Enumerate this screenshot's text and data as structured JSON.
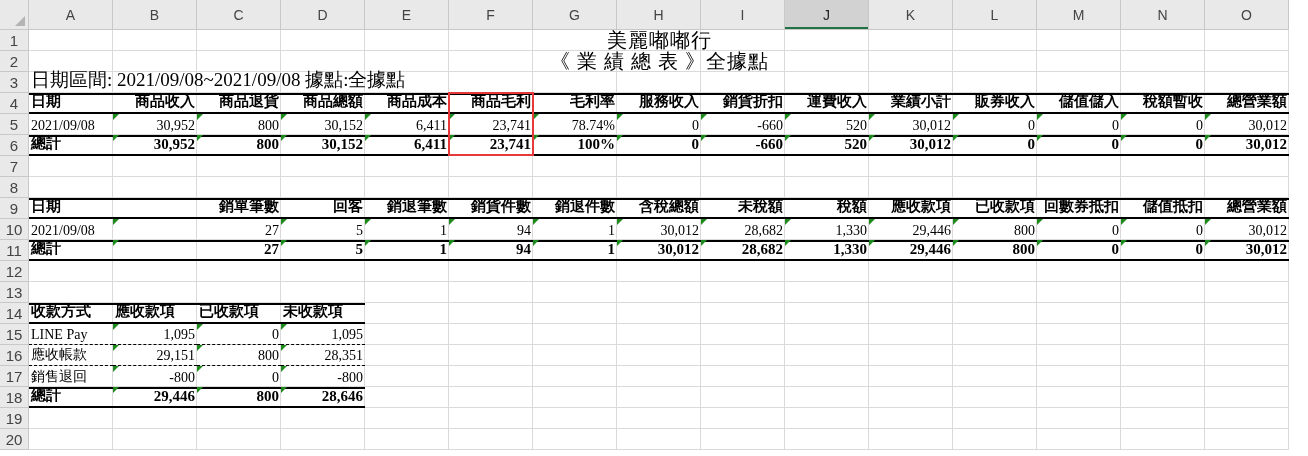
{
  "columns": [
    {
      "label": "A",
      "selected": false
    },
    {
      "label": "B",
      "selected": false
    },
    {
      "label": "C",
      "selected": false
    },
    {
      "label": "D",
      "selected": false
    },
    {
      "label": "E",
      "selected": false
    },
    {
      "label": "F",
      "selected": false
    },
    {
      "label": "G",
      "selected": false
    },
    {
      "label": "H",
      "selected": false
    },
    {
      "label": "I",
      "selected": false
    },
    {
      "label": "J",
      "selected": true
    },
    {
      "label": "K",
      "selected": false
    },
    {
      "label": "L",
      "selected": false
    },
    {
      "label": "M",
      "selected": false
    },
    {
      "label": "N",
      "selected": false
    },
    {
      "label": "O",
      "selected": false
    }
  ],
  "rows": [
    {
      "number": "1",
      "kind": "title",
      "cells": [
        {
          "text": "美麗嘟嘟行",
          "kind": "center"
        }
      ]
    },
    {
      "number": "2",
      "kind": "title",
      "cells": [
        {
          "text": "《 業 績 總 表 》全據點",
          "kind": "center"
        }
      ]
    },
    {
      "number": "3",
      "kind": "note",
      "cells": [
        {
          "text": "日期區間: 2021/09/08~2021/09/08 據點:全據點",
          "kind": "label"
        }
      ]
    },
    {
      "number": "4",
      "kind": "header",
      "cells": [
        {
          "text": "日期",
          "kind": "label",
          "flag": false,
          "outlined": false
        },
        {
          "text": "商品收入",
          "kind": "number",
          "flag": false,
          "outlined": false
        },
        {
          "text": "商品退貨",
          "kind": "number",
          "flag": false,
          "outlined": false
        },
        {
          "text": "商品總額",
          "kind": "number",
          "flag": false,
          "outlined": false
        },
        {
          "text": "商品成本",
          "kind": "number",
          "flag": false,
          "outlined": false
        },
        {
          "text": "商品毛利",
          "kind": "number",
          "flag": false,
          "outlined": true
        },
        {
          "text": "毛利率",
          "kind": "number",
          "flag": false,
          "outlined": false
        },
        {
          "text": "服務收入",
          "kind": "number",
          "flag": false,
          "outlined": false
        },
        {
          "text": "銷貨折扣",
          "kind": "number",
          "flag": false,
          "outlined": false
        },
        {
          "text": "運費收入",
          "kind": "number",
          "flag": false,
          "outlined": false
        },
        {
          "text": "業績小計",
          "kind": "number",
          "flag": false,
          "outlined": false
        },
        {
          "text": "販券收入",
          "kind": "number",
          "flag": false,
          "outlined": false
        },
        {
          "text": "儲值儲入",
          "kind": "number",
          "flag": false,
          "outlined": false
        },
        {
          "text": "稅額暫收",
          "kind": "number",
          "flag": false,
          "outlined": false
        },
        {
          "text": "總營業額",
          "kind": "number",
          "flag": false,
          "outlined": false
        }
      ]
    },
    {
      "number": "5",
      "kind": "data",
      "cells": [
        {
          "text": "2021/09/08",
          "kind": "label",
          "flag": false,
          "outlined": false
        },
        {
          "text": "30,952",
          "kind": "number",
          "flag": true,
          "outlined": false
        },
        {
          "text": "800",
          "kind": "number",
          "flag": true,
          "outlined": false
        },
        {
          "text": "30,152",
          "kind": "number",
          "flag": true,
          "outlined": false
        },
        {
          "text": "6,411",
          "kind": "number",
          "flag": true,
          "outlined": false
        },
        {
          "text": "23,741",
          "kind": "number",
          "flag": true,
          "outlined": true
        },
        {
          "text": "78.74%",
          "kind": "number",
          "flag": true,
          "outlined": false
        },
        {
          "text": "0",
          "kind": "number",
          "flag": true,
          "outlined": false
        },
        {
          "text": "-660",
          "kind": "number",
          "flag": true,
          "outlined": false
        },
        {
          "text": "520",
          "kind": "number",
          "flag": true,
          "outlined": false
        },
        {
          "text": "30,012",
          "kind": "number",
          "flag": true,
          "outlined": false
        },
        {
          "text": "0",
          "kind": "number",
          "flag": true,
          "outlined": false
        },
        {
          "text": "0",
          "kind": "number",
          "flag": true,
          "outlined": false
        },
        {
          "text": "0",
          "kind": "number",
          "flag": true,
          "outlined": false
        },
        {
          "text": "30,012",
          "kind": "number",
          "flag": true,
          "outlined": false
        }
      ]
    },
    {
      "number": "6",
      "kind": "total",
      "cells": [
        {
          "text": "總計",
          "kind": "label",
          "flag": false,
          "outlined": false
        },
        {
          "text": "30,952",
          "kind": "number",
          "flag": true,
          "outlined": false
        },
        {
          "text": "800",
          "kind": "number",
          "flag": true,
          "outlined": false
        },
        {
          "text": "30,152",
          "kind": "number",
          "flag": true,
          "outlined": false
        },
        {
          "text": "6,411",
          "kind": "number",
          "flag": true,
          "outlined": false
        },
        {
          "text": "23,741",
          "kind": "number",
          "flag": true,
          "outlined": true
        },
        {
          "text": "100%",
          "kind": "number",
          "flag": true,
          "outlined": false
        },
        {
          "text": "0",
          "kind": "number",
          "flag": true,
          "outlined": false
        },
        {
          "text": "-660",
          "kind": "number",
          "flag": true,
          "outlined": false
        },
        {
          "text": "520",
          "kind": "number",
          "flag": true,
          "outlined": false
        },
        {
          "text": "30,012",
          "kind": "number",
          "flag": true,
          "outlined": false
        },
        {
          "text": "0",
          "kind": "number",
          "flag": true,
          "outlined": false
        },
        {
          "text": "0",
          "kind": "number",
          "flag": true,
          "outlined": false
        },
        {
          "text": "0",
          "kind": "number",
          "flag": true,
          "outlined": false
        },
        {
          "text": "30,012",
          "kind": "number",
          "flag": true,
          "outlined": false
        }
      ]
    },
    {
      "number": "7",
      "kind": "blank"
    },
    {
      "number": "8",
      "kind": "blank"
    },
    {
      "number": "9",
      "kind": "header",
      "cells": [
        {
          "text": "日期",
          "kind": "label",
          "flag": false,
          "outlined": false
        },
        {
          "text": "銷單筆數",
          "kind": "wide",
          "flag": false,
          "outlined": false
        },
        {
          "text": "回客",
          "kind": "number",
          "flag": false,
          "outlined": false
        },
        {
          "text": "銷退筆數",
          "kind": "number",
          "flag": false,
          "outlined": false
        },
        {
          "text": "銷貨件數",
          "kind": "number",
          "flag": false,
          "outlined": false
        },
        {
          "text": "銷退件數",
          "kind": "number",
          "flag": false,
          "outlined": false
        },
        {
          "text": "含稅總額",
          "kind": "number",
          "flag": false,
          "outlined": false
        },
        {
          "text": "未稅額",
          "kind": "number",
          "flag": false,
          "outlined": false
        },
        {
          "text": "稅額",
          "kind": "number",
          "flag": false,
          "outlined": false
        },
        {
          "text": "應收款項",
          "kind": "number",
          "flag": false,
          "outlined": false
        },
        {
          "text": "已收款項",
          "kind": "number",
          "flag": false,
          "outlined": false
        },
        {
          "text": "回數券抵扣",
          "kind": "number",
          "flag": false,
          "outlined": false
        },
        {
          "text": "儲值抵扣",
          "kind": "number",
          "flag": false,
          "outlined": false
        },
        {
          "text": "總營業額",
          "kind": "number",
          "flag": false,
          "outlined": false
        }
      ]
    },
    {
      "number": "10",
      "kind": "data",
      "cells": [
        {
          "text": "2021/09/08",
          "kind": "label",
          "flag": false,
          "outlined": false
        },
        {
          "text": "27",
          "kind": "wide",
          "flag": true,
          "outlined": false
        },
        {
          "text": "5",
          "kind": "number",
          "flag": true,
          "outlined": false
        },
        {
          "text": "1",
          "kind": "number",
          "flag": true,
          "outlined": false
        },
        {
          "text": "94",
          "kind": "number",
          "flag": true,
          "outlined": false
        },
        {
          "text": "1",
          "kind": "number",
          "flag": true,
          "outlined": false
        },
        {
          "text": "30,012",
          "kind": "number",
          "flag": true,
          "outlined": false
        },
        {
          "text": "28,682",
          "kind": "number",
          "flag": true,
          "outlined": false
        },
        {
          "text": "1,330",
          "kind": "number",
          "flag": true,
          "outlined": false
        },
        {
          "text": "29,446",
          "kind": "number",
          "flag": true,
          "outlined": false
        },
        {
          "text": "800",
          "kind": "number",
          "flag": true,
          "outlined": false
        },
        {
          "text": "0",
          "kind": "number",
          "flag": true,
          "outlined": false
        },
        {
          "text": "0",
          "kind": "number",
          "flag": true,
          "outlined": false
        },
        {
          "text": "30,012",
          "kind": "number",
          "flag": true,
          "outlined": false
        }
      ]
    },
    {
      "number": "11",
      "kind": "total",
      "cells": [
        {
          "text": "總計",
          "kind": "label",
          "flag": false,
          "outlined": false
        },
        {
          "text": "27",
          "kind": "wide",
          "flag": true,
          "outlined": false
        },
        {
          "text": "5",
          "kind": "number",
          "flag": true,
          "outlined": false
        },
        {
          "text": "1",
          "kind": "number",
          "flag": true,
          "outlined": false
        },
        {
          "text": "94",
          "kind": "number",
          "flag": true,
          "outlined": false
        },
        {
          "text": "1",
          "kind": "number",
          "flag": true,
          "outlined": false
        },
        {
          "text": "30,012",
          "kind": "number",
          "flag": true,
          "outlined": false
        },
        {
          "text": "28,682",
          "kind": "number",
          "flag": true,
          "outlined": false
        },
        {
          "text": "1,330",
          "kind": "number",
          "flag": true,
          "outlined": false
        },
        {
          "text": "29,446",
          "kind": "number",
          "flag": true,
          "outlined": false
        },
        {
          "text": "800",
          "kind": "number",
          "flag": true,
          "outlined": false
        },
        {
          "text": "0",
          "kind": "number",
          "flag": true,
          "outlined": false
        },
        {
          "text": "0",
          "kind": "number",
          "flag": true,
          "outlined": false
        },
        {
          "text": "30,012",
          "kind": "number",
          "flag": true,
          "outlined": false
        }
      ]
    },
    {
      "number": "12",
      "kind": "blank"
    },
    {
      "number": "13",
      "kind": "blank"
    },
    {
      "number": "14",
      "kind": "header",
      "cells": [
        {
          "text": "收款方式",
          "kind": "label",
          "flag": false,
          "outlined": false
        },
        {
          "text": "應收款項",
          "kind": "label",
          "flag": false,
          "outlined": false
        },
        {
          "text": "已收款項",
          "kind": "label",
          "flag": false,
          "outlined": false
        },
        {
          "text": "未收款項",
          "kind": "label",
          "flag": false,
          "outlined": false
        }
      ]
    },
    {
      "number": "15",
      "kind": "data",
      "cells": [
        {
          "text": "LINE Pay",
          "kind": "label",
          "flag": false,
          "outlined": false
        },
        {
          "text": "1,095",
          "kind": "number",
          "flag": true,
          "outlined": false
        },
        {
          "text": "0",
          "kind": "number",
          "flag": true,
          "outlined": false
        },
        {
          "text": "1,095",
          "kind": "number",
          "flag": true,
          "outlined": false
        }
      ]
    },
    {
      "number": "16",
      "kind": "data",
      "cells": [
        {
          "text": "應收帳款",
          "kind": "label",
          "flag": false,
          "outlined": false
        },
        {
          "text": "29,151",
          "kind": "number",
          "flag": true,
          "outlined": false
        },
        {
          "text": "800",
          "kind": "number",
          "flag": true,
          "outlined": false
        },
        {
          "text": "28,351",
          "kind": "number",
          "flag": true,
          "outlined": false
        }
      ]
    },
    {
      "number": "17",
      "kind": "data",
      "cells": [
        {
          "text": "銷售退回",
          "kind": "label",
          "flag": false,
          "outlined": false
        },
        {
          "text": "-800",
          "kind": "number",
          "flag": true,
          "outlined": false
        },
        {
          "text": "0",
          "kind": "number",
          "flag": true,
          "outlined": false
        },
        {
          "text": "-800",
          "kind": "number",
          "flag": true,
          "outlined": false
        }
      ]
    },
    {
      "number": "18",
      "kind": "total",
      "cells": [
        {
          "text": "總計",
          "kind": "label",
          "flag": false,
          "outlined": false
        },
        {
          "text": "29,446",
          "kind": "number",
          "flag": true,
          "outlined": false
        },
        {
          "text": "800",
          "kind": "number",
          "flag": true,
          "outlined": false
        },
        {
          "text": "28,646",
          "kind": "number",
          "flag": true,
          "outlined": false
        }
      ]
    },
    {
      "number": "19",
      "kind": "blank"
    },
    {
      "number": "20",
      "kind": "blank"
    }
  ]
}
